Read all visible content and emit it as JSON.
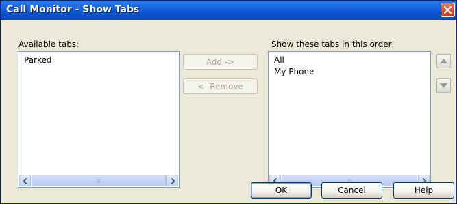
{
  "window": {
    "title": "Call Monitor - Show Tabs"
  },
  "available": {
    "label": "Available tabs:",
    "items": [
      "Parked"
    ]
  },
  "shown": {
    "label": "Show these tabs in this order:",
    "items": [
      "All",
      "My Phone"
    ]
  },
  "buttons": {
    "add": "Add ->",
    "remove": "<- Remove",
    "ok": "OK",
    "cancel": "Cancel",
    "help": "Help"
  },
  "scroll_grip": "III",
  "icons": {
    "close": "close-icon",
    "move_up": "triangle-up-icon",
    "move_down": "triangle-down-icon",
    "scroll_left": "arrow-left-icon",
    "scroll_right": "arrow-right-icon"
  },
  "colors": {
    "titlebar": "#0a52cc",
    "dialog_bg": "#ece9d8",
    "close": "#d6502c"
  }
}
